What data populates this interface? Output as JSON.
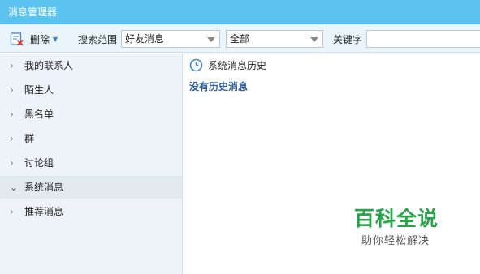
{
  "window": {
    "title": "消息管理器"
  },
  "toolbar": {
    "delete_label": "删除",
    "search_scope_label": "搜索范围",
    "scope_select_value": "好友消息",
    "filter_select_value": "全部",
    "keyword_label": "关键字",
    "keyword_value": ""
  },
  "sidebar": {
    "items": [
      {
        "label": "我的联系人",
        "expanded": false
      },
      {
        "label": "陌生人",
        "expanded": false
      },
      {
        "label": "黑名单",
        "expanded": false
      },
      {
        "label": "群",
        "expanded": false
      },
      {
        "label": "讨论组",
        "expanded": false
      },
      {
        "label": "系统消息",
        "expanded": true
      },
      {
        "label": "推荐消息",
        "expanded": false
      }
    ]
  },
  "main": {
    "history_title": "系统消息历史",
    "empty_text": "没有历史消息"
  },
  "watermark": {
    "title": "百科全说",
    "subtitle": "助你轻松解决"
  },
  "colors": {
    "titlebar": "#5cc2f0",
    "sidebar_bg": "#edf3f8",
    "link_blue": "#2f5f9a",
    "watermark_green": "#2aa44a"
  },
  "icons": {
    "delete": "delete-doc-icon",
    "history": "clock-icon",
    "expand": "chevron-right-icon",
    "collapse": "chevron-down-icon"
  }
}
